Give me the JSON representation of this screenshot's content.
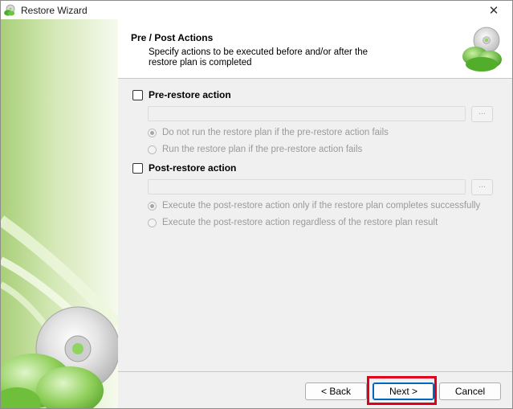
{
  "window": {
    "title": "Restore Wizard",
    "close_glyph": "✕"
  },
  "header": {
    "title": "Pre / Post Actions",
    "description": "Specify actions to be executed before and/or after the restore plan is completed"
  },
  "pre_restore": {
    "label": "Pre-restore action",
    "checked": false,
    "path_value": "",
    "browse_label": "...",
    "options": [
      {
        "label": "Do not run the restore plan if the pre-restore action fails",
        "selected": true
      },
      {
        "label": "Run the restore plan if the pre-restore action fails",
        "selected": false
      }
    ]
  },
  "post_restore": {
    "label": "Post-restore action",
    "checked": false,
    "path_value": "",
    "browse_label": "...",
    "options": [
      {
        "label": "Execute the post-restore action only if the restore plan completes successfully",
        "selected": true
      },
      {
        "label": "Execute the post-restore action regardless of the restore plan result",
        "selected": false
      }
    ]
  },
  "footer": {
    "back_label": "< Back",
    "next_label": "Next >",
    "cancel_label": "Cancel"
  },
  "colors": {
    "highlight": "#e0001b",
    "sidebar_green": "#a9cf78",
    "accent": "#0067c0"
  },
  "icons": {
    "app": "cloud-disc-icon",
    "header": "cloud-disc-icon",
    "sidebar": "disc-cloud-art"
  }
}
